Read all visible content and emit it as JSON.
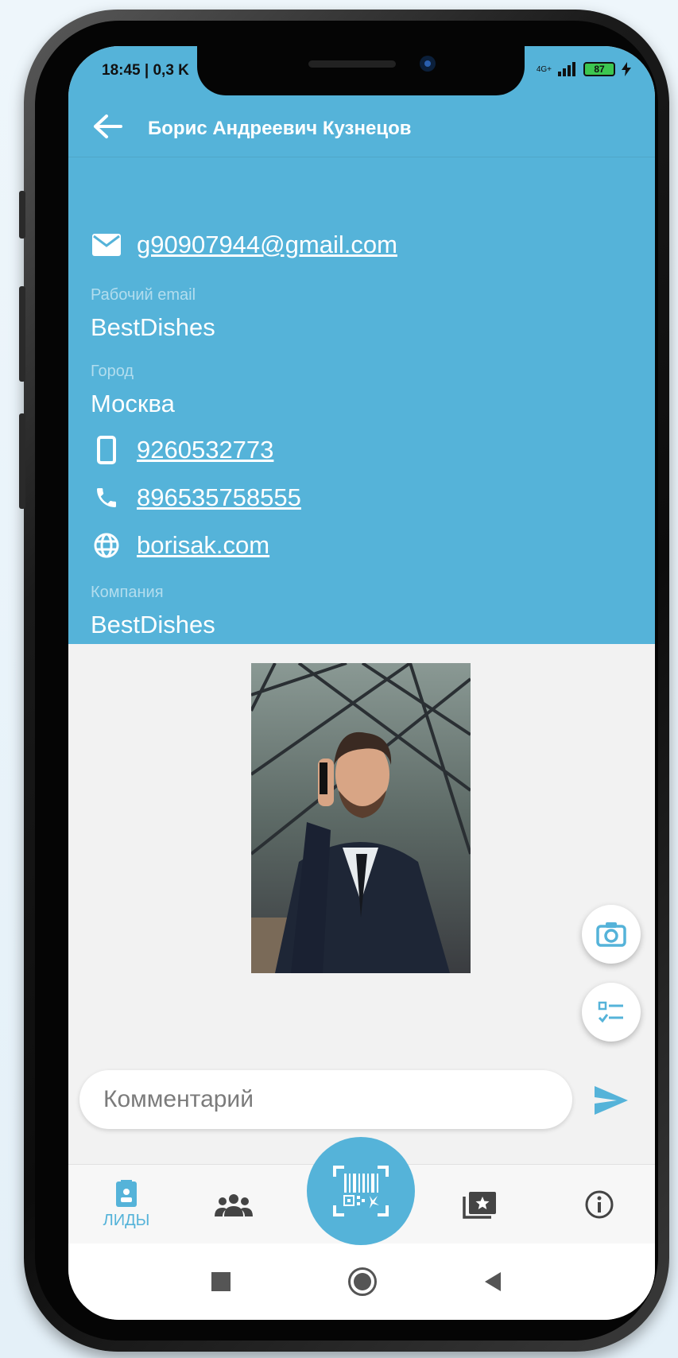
{
  "status": {
    "time": "18:45 | 0,3 K",
    "signal": "4G+",
    "battery": "87"
  },
  "header": {
    "title": "Борис Андреевич Кузнецов"
  },
  "contact": {
    "email": "g90907944@gmail.com",
    "work_email_label": "Рабочий email",
    "work_email_value": "BestDishes",
    "city_label": "Город",
    "city_value": "Москва",
    "mobile": "9260532773",
    "phone": "896535758555",
    "website": "borisak.com",
    "company_label": "Компания",
    "company_value": "BestDishes"
  },
  "comment": {
    "placeholder": "Комментарий"
  },
  "nav": {
    "leads_label": "ЛИДЫ"
  },
  "colors": {
    "accent": "#55b3d9",
    "background": "#f2f2f2"
  },
  "icons": [
    "back-arrow-icon",
    "email-icon",
    "mobile-icon",
    "phone-icon",
    "globe-icon",
    "camera-icon",
    "checklist-icon",
    "send-icon",
    "leads-icon",
    "people-icon",
    "barcode-scan-icon",
    "folder-star-icon",
    "info-icon"
  ]
}
